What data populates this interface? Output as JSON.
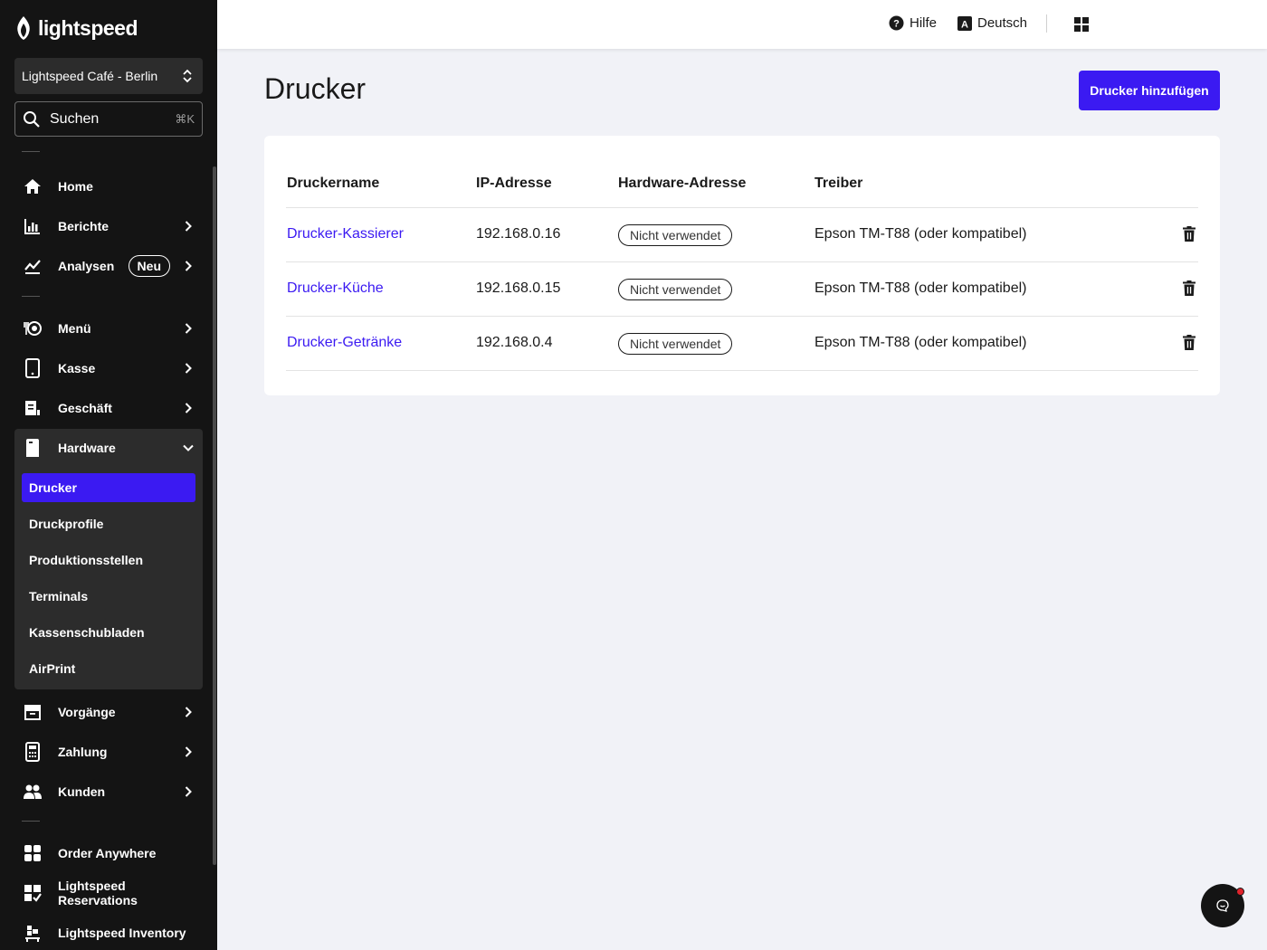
{
  "brand": {
    "name": "lightspeed"
  },
  "store_selector": {
    "label": "Lightspeed Café - Berlin"
  },
  "search": {
    "label": "Suchen",
    "shortcut": "⌘K"
  },
  "nav": {
    "home": "Home",
    "berichte": "Berichte",
    "analysen": "Analysen",
    "analysen_badge": "Neu",
    "menu": "Menü",
    "kasse": "Kasse",
    "geschaeft": "Geschäft",
    "hardware": "Hardware",
    "hardware_sub": [
      "Drucker",
      "Druckprofile",
      "Produktionsstellen",
      "Terminals",
      "Kassenschubladen",
      "AirPrint"
    ],
    "vorgaenge": "Vorgänge",
    "zahlung": "Zahlung",
    "kunden": "Kunden",
    "order_anywhere": "Order Anywhere",
    "reservations": "Lightspeed Reservations",
    "inventory": "Lightspeed Inventory"
  },
  "topbar": {
    "help": "Hilfe",
    "language": "Deutsch"
  },
  "page": {
    "title": "Drucker",
    "add_button": "Drucker hinzufügen"
  },
  "table": {
    "headers": [
      "Druckername",
      "IP-Adresse",
      "Hardware-Adresse",
      "Treiber"
    ],
    "rows": [
      {
        "name": "Drucker-Kassierer",
        "ip": "192.168.0.16",
        "hw": "Nicht verwendet",
        "driver": "Epson TM-T88 (oder kompatibel)"
      },
      {
        "name": "Drucker-Küche",
        "ip": "192.168.0.15",
        "hw": "Nicht verwendet",
        "driver": "Epson TM-T88 (oder kompatibel)"
      },
      {
        "name": "Drucker-Getränke",
        "ip": "192.168.0.4",
        "hw": "Nicht verwendet",
        "driver": "Epson TM-T88 (oder kompatibel)"
      }
    ]
  },
  "colors": {
    "accent": "#3b1af2",
    "sidebar_bg": "#141414",
    "sidebar_group_bg": "#2c2c2c",
    "page_bg": "#f1f2f7",
    "notification": "#e0242c"
  }
}
